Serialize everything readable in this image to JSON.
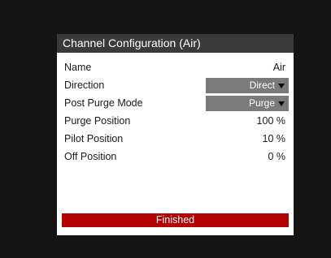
{
  "dialog": {
    "title": "Channel Configuration  (Air)"
  },
  "rows": {
    "name": {
      "label": "Name",
      "value": "Air"
    },
    "direction": {
      "label": "Direction",
      "value": "Direct"
    },
    "post_purge_mode": {
      "label": "Post Purge Mode",
      "value": "Purge"
    },
    "purge_position": {
      "label": "Purge Position",
      "value": "100 %"
    },
    "pilot_position": {
      "label": "Pilot Position",
      "value": "10 %"
    },
    "off_position": {
      "label": "Off Position",
      "value": "0 %"
    }
  },
  "status": {
    "text": "Finished",
    "color": "#b30000"
  },
  "icons": {
    "dropdown_arrow": "triangle-down-icon"
  }
}
